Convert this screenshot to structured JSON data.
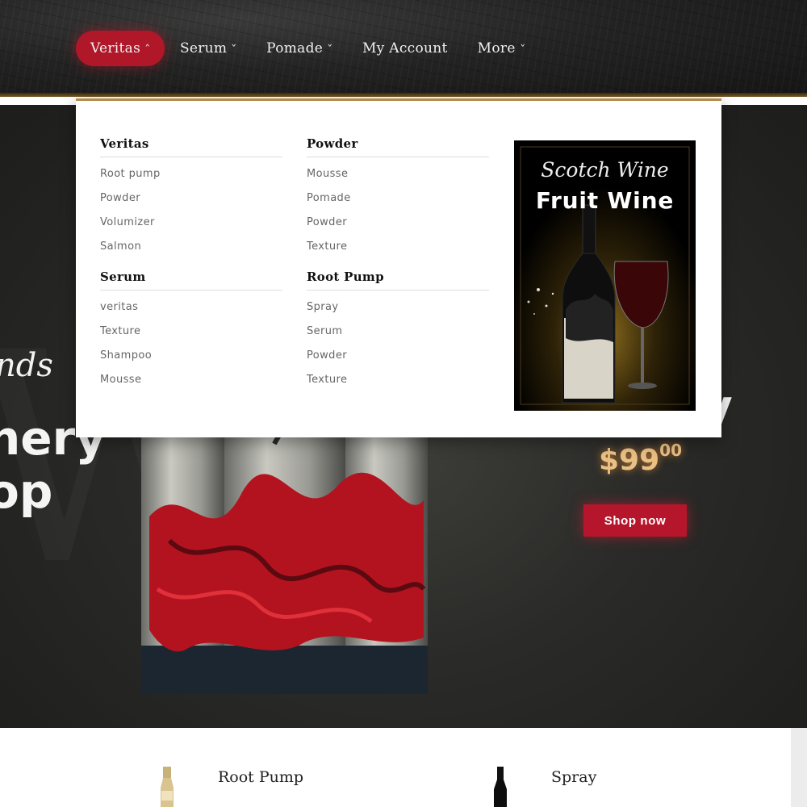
{
  "nav": {
    "items": [
      {
        "label": "Veritas",
        "active": true,
        "caret": "chevron-up"
      },
      {
        "label": "Serum",
        "caret": "chevron-down"
      },
      {
        "label": "Pomade",
        "caret": "chevron-down"
      },
      {
        "label": "My Account"
      },
      {
        "label": "More",
        "caret": "chevron-down"
      }
    ]
  },
  "mega_menu": {
    "columns": [
      {
        "heading": "Veritas",
        "items": [
          "Root pump",
          "Powder",
          "Volumizer",
          "Salmon"
        ]
      },
      {
        "heading": "Powder",
        "items": [
          "Mousse",
          "Pomade",
          "Powder",
          "Texture"
        ]
      },
      {
        "heading": "Serum",
        "items": [
          "veritas",
          "Texture",
          "Shampoo",
          "Mousse"
        ]
      },
      {
        "heading": "Root Pump",
        "items": [
          "Spray",
          "Serum",
          "Powder",
          "Texture"
        ]
      }
    ],
    "promo": {
      "script_text": "Scotch Wine",
      "title": "Fruit Wine"
    }
  },
  "hero": {
    "script_text": "nds",
    "big_line1": "nery",
    "big_line2": "op",
    "right_partial": "y",
    "price_main": "$99",
    "price_cents": "00",
    "cta": "Shop now"
  },
  "products": [
    {
      "name": "Root Pump"
    },
    {
      "name": "Spray"
    }
  ],
  "colors": {
    "accent": "#b0182a",
    "gold": "#b48a4c",
    "price": "#e9c184"
  }
}
